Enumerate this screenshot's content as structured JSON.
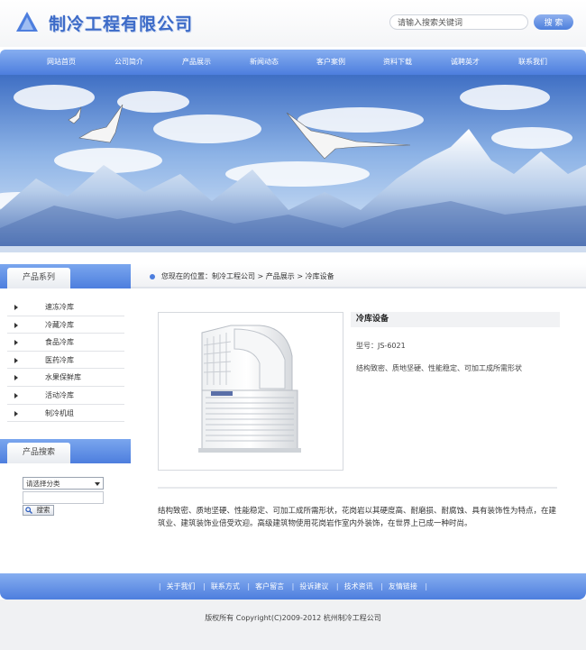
{
  "header": {
    "logo_text": "制冷工程有限公司",
    "search_placeholder": "请输入搜索关键词",
    "search_button": "搜 索"
  },
  "nav": {
    "items": [
      "网站首页",
      "公司简介",
      "产品展示",
      "新闻动态",
      "客户案例",
      "资料下载",
      "诚聘英才",
      "联系我们"
    ]
  },
  "sidebar": {
    "products_heading": "产品系列",
    "items": [
      "速冻冷库",
      "冷藏冷库",
      "食品冷库",
      "医药冷库",
      "水果保鲜库",
      "活动冷库",
      "制冷机组"
    ],
    "search_heading": "产品搜索",
    "category_select": "请选择分类",
    "search_button": "搜索"
  },
  "breadcrumb": {
    "text": "您现在的位置：制冷工程公司 > 产品展示 > 冷库设备"
  },
  "product": {
    "title": "冷库设备",
    "model": "型号：JS-6021",
    "short_desc": "结构致密、质地坚硬、性能稳定、可加工成所需形状",
    "description": "结构致密、质地坚硬、性能稳定、可加工成所需形状，花岗岩以其硬度高、耐磨损、耐腐蚀、具有装饰性为特点，在建筑业、建筑装饰业倍受欢迎。高级建筑物使用花岗岩作室内外装饰，在世界上已成一种时尚。"
  },
  "footer": {
    "links": [
      "关于我们",
      "联系方式",
      "客户留言",
      "投诉建议",
      "技术资讯",
      "友情链接"
    ],
    "copyright": "版权所有  Copyright(C)2009-2012 杭州制冷工程公司"
  },
  "colors": {
    "accent": "#4d7ede",
    "accent_light": "#86aef0"
  }
}
